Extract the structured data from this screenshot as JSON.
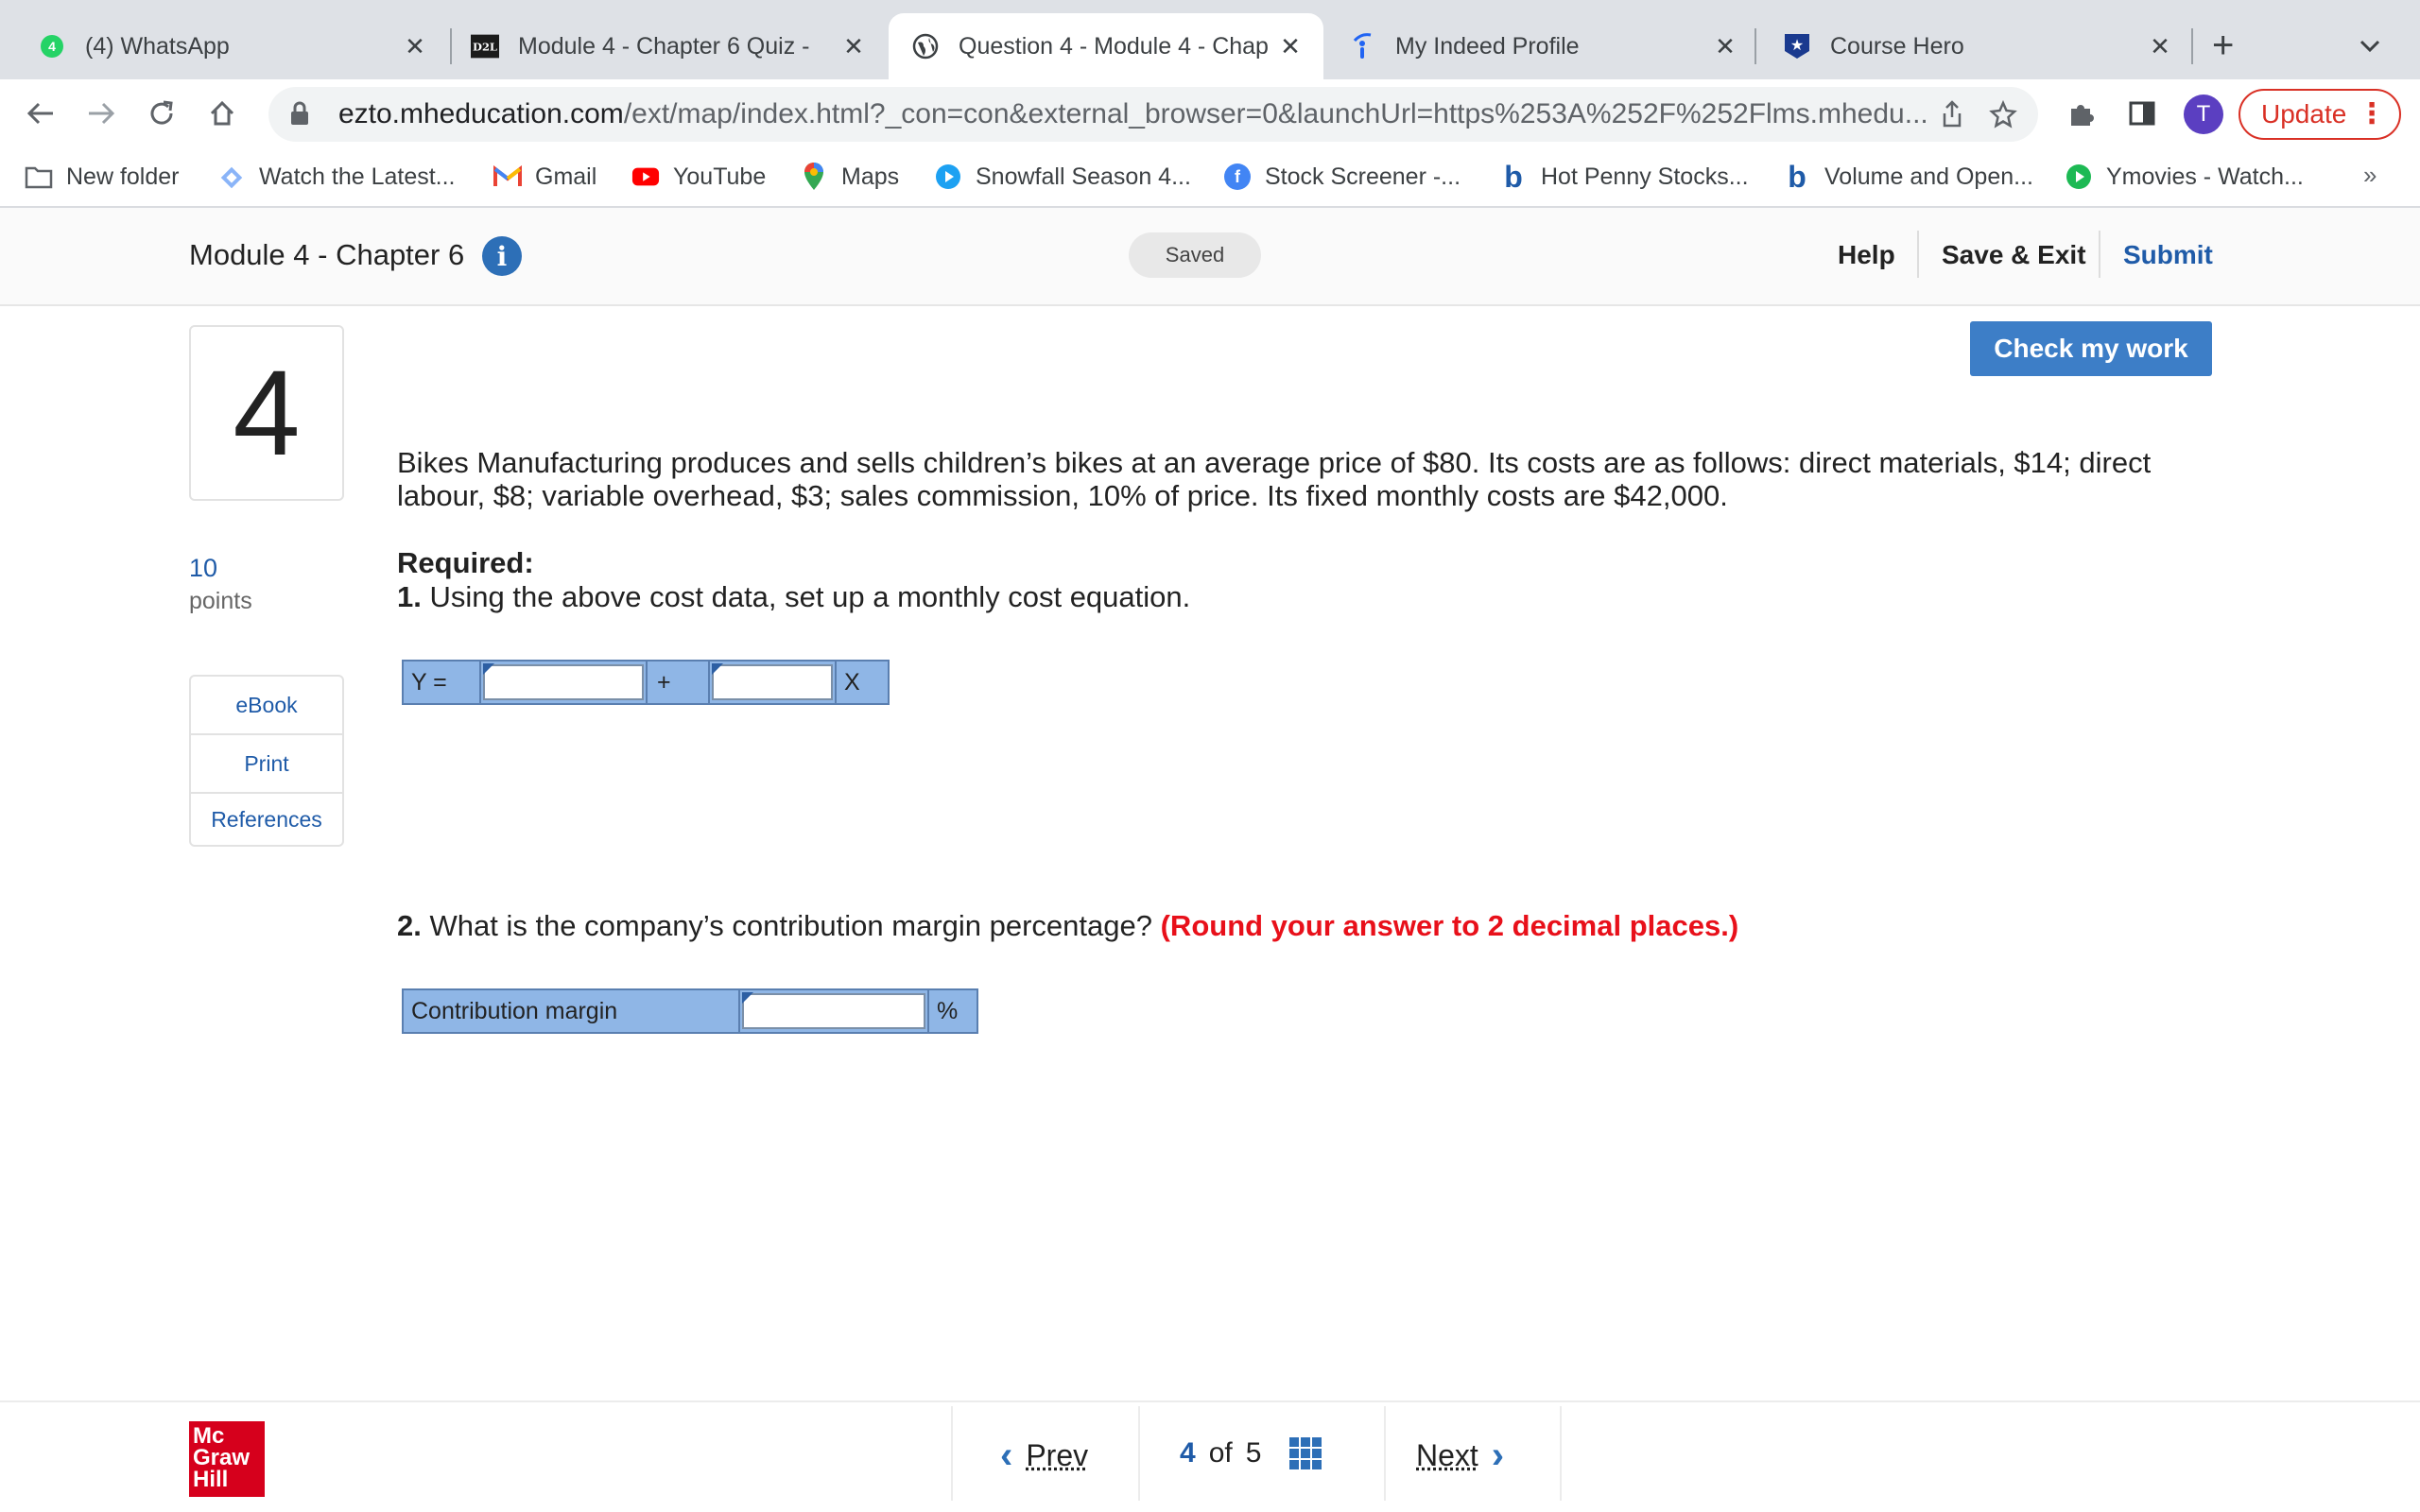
{
  "browser": {
    "tabs": [
      {
        "title": "(4) WhatsApp",
        "icon": "whatsapp-icon"
      },
      {
        "title": "Module 4 - Chapter 6 Quiz - ",
        "icon": "d2l-icon"
      },
      {
        "title": "Question 4 - Module 4 - Chap",
        "icon": "globe-icon"
      },
      {
        "title": "My Indeed Profile",
        "icon": "indeed-icon"
      },
      {
        "title": "Course Hero",
        "icon": "coursehero-icon"
      }
    ],
    "whatsapp_badge": "4",
    "d2l_label": "D2L",
    "url_host": "ezto.mheducation.com",
    "url_rest": "/ext/map/index.html?_con=con&external_browser=0&launchUrl=https%253A%252F%252Flms.mhedu...",
    "avatar_letter": "T",
    "update_label": "Update",
    "bookmarks": [
      {
        "label": "New folder",
        "icon": "folder-icon"
      },
      {
        "label": "Watch the Latest...",
        "icon": "ticket-icon"
      },
      {
        "label": "Gmail",
        "icon": "gmail-icon"
      },
      {
        "label": "YouTube",
        "icon": "youtube-icon"
      },
      {
        "label": "Maps",
        "icon": "maps-icon"
      },
      {
        "label": "Snowfall Season 4...",
        "icon": "play-icon"
      },
      {
        "label": "Stock Screener -...",
        "icon": "finance-icon"
      },
      {
        "label": "Hot Penny Stocks...",
        "icon": "b-icon"
      },
      {
        "label": "Volume and Open...",
        "icon": "b-icon"
      },
      {
        "label": "Ymovies - Watch...",
        "icon": "play-green-icon"
      }
    ],
    "bookmarks_more": "»"
  },
  "header": {
    "title": "Module 4 - Chapter 6",
    "info_glyph": "i",
    "saved": "Saved",
    "help": "Help",
    "save_exit": "Save & Exit",
    "submit": "Submit"
  },
  "question": {
    "number": "4",
    "points_value": "10",
    "points_label": "points",
    "side_links": [
      "eBook",
      "Print",
      "References"
    ],
    "check_button": "Check my work",
    "text": "Bikes Manufacturing produces and sells children’s bikes at an average price of $80. Its costs are as follows: direct materials, $14; direct labour, $8; variable overhead, $3; sales commission, 10% of price. Its fixed monthly costs are $42,000.",
    "required_label": "Required:",
    "req1_num": "1.",
    "req1_text": " Using the above cost data, set up a monthly cost equation.",
    "equation": {
      "y_label": "Y =",
      "plus": "+",
      "x_label": "X",
      "input1": "",
      "input2": ""
    },
    "req2_num": "2.",
    "req2_text": " What is the company’s contribution margin percentage? ",
    "req2_note": "(Round your answer to 2 decimal places.)",
    "cm": {
      "label": "Contribution margin",
      "unit": "%",
      "input": ""
    }
  },
  "footer": {
    "logo_lines": [
      "Mc",
      "Graw",
      "Hill"
    ],
    "prev": "Prev",
    "current": "4",
    "of": "of",
    "total": "5",
    "next": "Next"
  }
}
